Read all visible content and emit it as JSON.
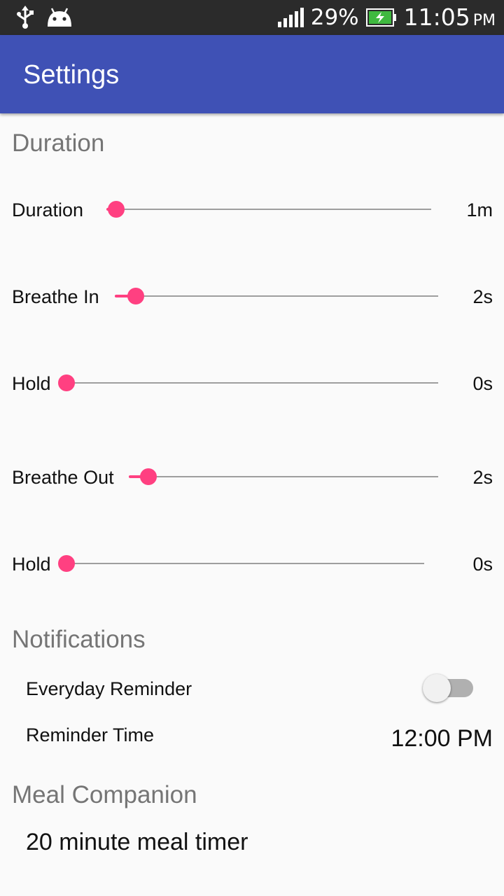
{
  "status_bar": {
    "battery_percent": "29%",
    "time": "11:05",
    "ampm": "PM",
    "icons": [
      "usb-icon",
      "android-icon",
      "signal-icon",
      "battery-charging-icon"
    ]
  },
  "app_bar": {
    "title": "Settings",
    "color": "#3f51b5"
  },
  "accent_color": "#ff4081",
  "sections": {
    "duration": {
      "header": "Duration",
      "sliders": [
        {
          "label": "Duration",
          "value": "1m",
          "level": 0.0
        },
        {
          "label": "Breathe In",
          "value": "2s",
          "level": 0.07
        },
        {
          "label": "Hold",
          "value": "0s",
          "level": 0.0
        },
        {
          "label": "Breathe Out",
          "value": "2s",
          "level": 0.07
        },
        {
          "label": "Hold",
          "value": "0s",
          "level": 0.0
        }
      ]
    },
    "notifications": {
      "header": "Notifications",
      "everyday_reminder": {
        "label": "Everyday Reminder",
        "enabled": false
      },
      "reminder_time": {
        "label": "Reminder Time",
        "value": "12:00 PM"
      }
    },
    "meal": {
      "header": "Meal Companion",
      "item": "20 minute meal timer"
    }
  }
}
